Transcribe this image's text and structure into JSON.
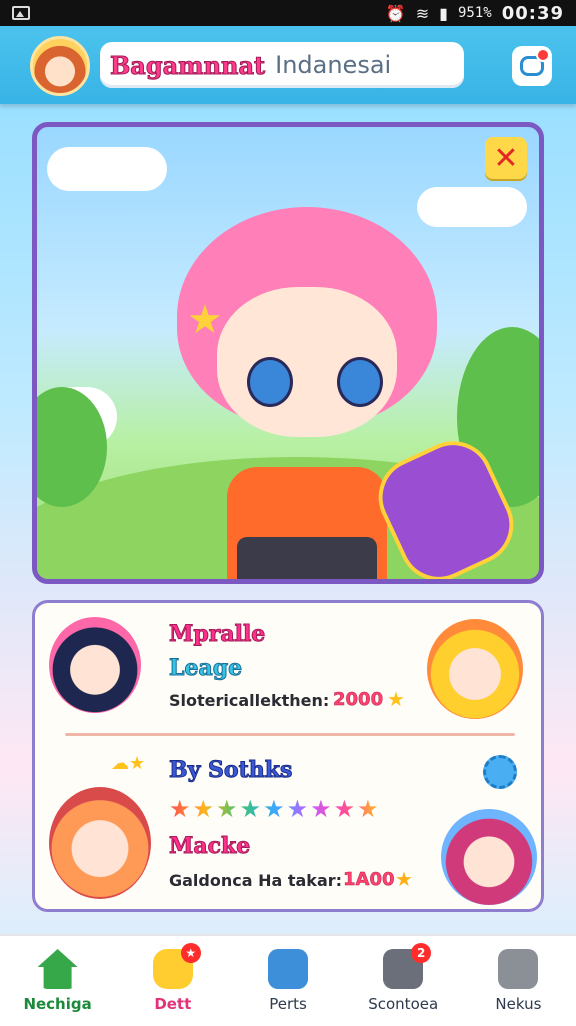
{
  "status_bar": {
    "battery": "951%",
    "time": "00:39"
  },
  "header": {
    "brand": "Bagamnnat",
    "subtitle": "Indanesai"
  },
  "hero": {
    "close_symbol": "✕"
  },
  "info": {
    "top": {
      "headline": "Mpralle",
      "subhead": "Leage",
      "stat_label": "Slotericallekthen:",
      "stat_value": "2000"
    },
    "bottom": {
      "headline": "By Sothks",
      "stars": "★★★★★★★★★",
      "subhead": "Macke",
      "stat_label": "Galdonca Ha takar:",
      "stat_value": "1A00"
    }
  },
  "nav": {
    "items": [
      {
        "label": "Nechiga",
        "icon": "home-icon",
        "color": "#37a84a"
      },
      {
        "label": "Dett",
        "icon": "chat-heart-icon",
        "color": "#ffcd2f",
        "badge": "★"
      },
      {
        "label": "Perts",
        "icon": "edit-card-icon",
        "color": "#3d8fd9"
      },
      {
        "label": "Scontoea",
        "icon": "calculator-icon",
        "color": "#6a6f7a",
        "badge": "2"
      },
      {
        "label": "Nekus",
        "icon": "map-icon",
        "color": "#8b8f96"
      }
    ]
  }
}
